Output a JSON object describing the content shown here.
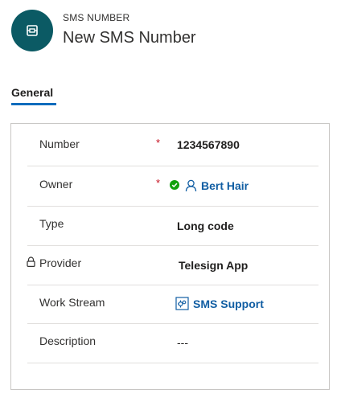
{
  "header": {
    "entity_type": "SMS NUMBER",
    "title": "New SMS Number",
    "icon": "sms-number-icon",
    "icon_color": "#0b5a64"
  },
  "tabs": [
    {
      "label": "General",
      "selected": true
    }
  ],
  "form": {
    "number": {
      "label": "Number",
      "required": "*",
      "value": "1234567890"
    },
    "owner": {
      "label": "Owner",
      "required": "*",
      "value": "Bert Hair",
      "icon": "person-icon",
      "status_icon": "check-circle-icon"
    },
    "type": {
      "label": "Type",
      "value": "Long code"
    },
    "provider": {
      "label": "Provider",
      "value": "Telesign App",
      "locked_icon": "lock-icon"
    },
    "work_stream": {
      "label": "Work Stream",
      "value": "SMS Support",
      "icon": "work-stream-icon"
    },
    "description": {
      "label": "Description",
      "value": "---"
    }
  },
  "colors": {
    "accent": "#0f6cbd",
    "link": "#115ea3",
    "required": "#c50f1f",
    "success": "#13a10e"
  }
}
